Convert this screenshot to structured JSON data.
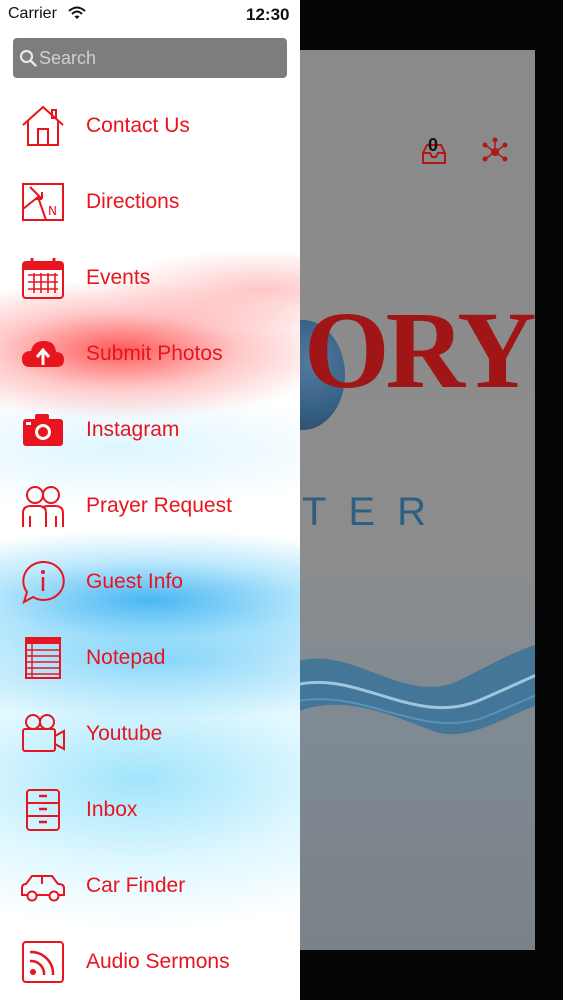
{
  "status_bar": {
    "carrier": "Carrier",
    "time": "12:30"
  },
  "search": {
    "placeholder": "Search"
  },
  "menu": {
    "items": [
      {
        "label": "Contact Us",
        "icon": "house-icon"
      },
      {
        "label": "Directions",
        "icon": "map-icon"
      },
      {
        "label": "Events",
        "icon": "calendar-icon"
      },
      {
        "label": "Submit Photos",
        "icon": "cloud-upload-icon"
      },
      {
        "label": "Instagram",
        "icon": "camera-icon"
      },
      {
        "label": "Prayer Request",
        "icon": "people-icon"
      },
      {
        "label": "Guest Info",
        "icon": "info-bubble-icon"
      },
      {
        "label": "Notepad",
        "icon": "notepad-icon"
      },
      {
        "label": "Youtube",
        "icon": "video-camera-icon"
      },
      {
        "label": "Inbox",
        "icon": "cabinet-icon"
      },
      {
        "label": "Car Finder",
        "icon": "car-icon"
      },
      {
        "label": "Audio Sermons",
        "icon": "rss-icon"
      }
    ]
  },
  "background_app": {
    "inbox_badge": "0",
    "logo_text": "ORY",
    "logo_subtext": "TER"
  },
  "colors": {
    "accent": "#e8141e",
    "search_bg": "#7d7d7d"
  }
}
